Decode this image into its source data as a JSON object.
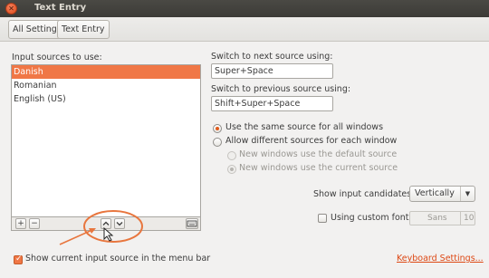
{
  "window": {
    "title": "Text Entry"
  },
  "breadcrumb": {
    "all_settings": "All Settings",
    "current": "Text Entry"
  },
  "sources": {
    "label": "Input sources to use:",
    "items": [
      "Danish",
      "Romanian",
      "English (US)"
    ],
    "selected_index": 0,
    "add_label": "+",
    "remove_label": "−"
  },
  "shortcuts": {
    "next_label": "Switch to next source using:",
    "next_value": "Super+Space",
    "prev_label": "Switch to previous source using:",
    "prev_value": "Shift+Super+Space"
  },
  "source_mode": {
    "same_label": "Use the same source for all windows",
    "different_label": "Allow different sources for each window",
    "new_default_label": "New windows use the default source",
    "new_current_label": "New windows use the current source"
  },
  "candidates": {
    "label": "Show input candidates:",
    "value": "Vertically"
  },
  "custom_font": {
    "label": "Using custom font:",
    "font_name": "Sans",
    "font_size": "10"
  },
  "footer": {
    "show_current_label": "Show current input source in the menu bar",
    "keyboard_settings": "Keyboard Settings..."
  },
  "colors": {
    "accent": "#f07746",
    "annotation": "#e8763e"
  }
}
